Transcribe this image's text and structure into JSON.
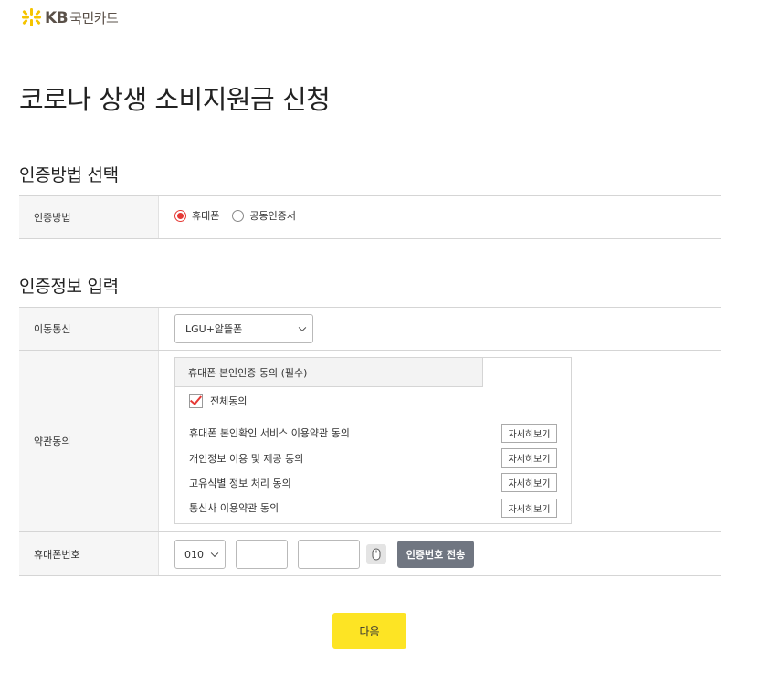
{
  "header": {
    "logo_text": "KB",
    "logo_text_kr": "국민카드",
    "brand_color": "#f5c400"
  },
  "page_title": "코로나 상생 소비지원금 신청",
  "auth_method": {
    "section_title": "인증방법 선택",
    "label": "인증방법",
    "options": [
      {
        "label": "휴대폰",
        "checked": true
      },
      {
        "label": "공동인증서",
        "checked": false
      }
    ]
  },
  "auth_info": {
    "section_title": "인증정보 입력",
    "carrier": {
      "label": "이동통신",
      "value": "LGU+알뜰폰"
    },
    "terms": {
      "label": "약관동의",
      "header": "휴대폰 본인인증 동의 (필수)",
      "agree_all": "전체동의",
      "agree_all_checked": true,
      "items": [
        {
          "label": "휴대폰 본인확인 서비스 이용약관 동의",
          "button": "자세히보기"
        },
        {
          "label": "개인정보 이용 및 제공 동의",
          "button": "자세히보기"
        },
        {
          "label": "고유식별 정보 처리 동의",
          "button": "자세히보기"
        },
        {
          "label": "통신사 이용약관 동의",
          "button": "자세히보기"
        }
      ]
    },
    "phone": {
      "label": "휴대폰번호",
      "prefix": "010",
      "separator": "-",
      "middle": "",
      "last": "",
      "send_button": "인증번호 전송"
    }
  },
  "next_button": "다음",
  "accent_colors": {
    "radio_checked": "#e53935",
    "next_button": "#fde424",
    "send_button": "#707681"
  }
}
